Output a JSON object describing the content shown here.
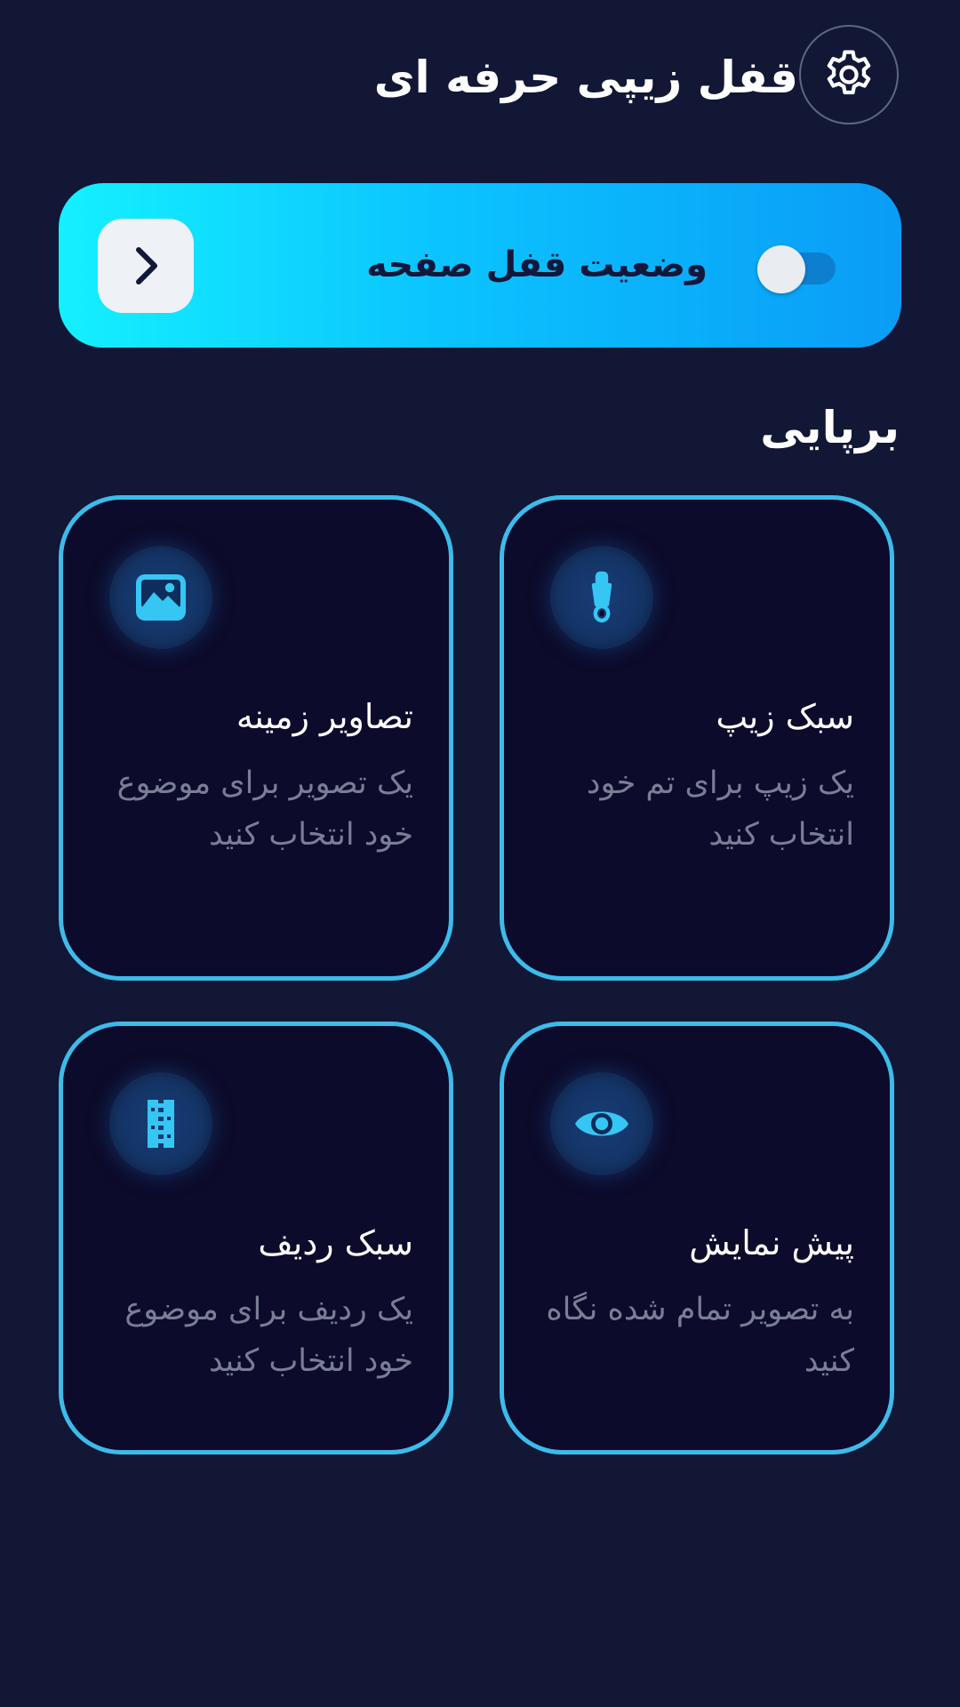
{
  "header": {
    "title": "قفل زیپی حرفه ای",
    "settings_icon": "gear-icon"
  },
  "lock_banner": {
    "label": "وضعیت قفل صفحه",
    "toggle_on": false,
    "arrow_icon": "chevron-right-icon",
    "gradient_colors": [
      "#14f0ff",
      "#0a9cf6"
    ]
  },
  "setup": {
    "title": "برپایی",
    "cards": [
      {
        "title": "سبک زیپ",
        "description": "یک زیپ برای تم خود انتخاب کنید",
        "icon": "zipper-icon"
      },
      {
        "title": "تصاویر زمینه",
        "description": "یک تصویر برای موضوع خود انتخاب کنید",
        "icon": "image-icon"
      },
      {
        "title": "پیش نمایش",
        "description": "به تصویر تمام شده نگاه کنید",
        "icon": "eye-icon"
      },
      {
        "title": "سبک ردیف",
        "description": "یک ردیف برای موضوع خود انتخاب کنید",
        "icon": "zipper-row-icon"
      }
    ]
  },
  "colors": {
    "background": "#111735",
    "card_border": "#3dbbea",
    "card_background": "#0c0b2b",
    "icon_color": "#36c6f4",
    "description_text": "#797e95"
  }
}
